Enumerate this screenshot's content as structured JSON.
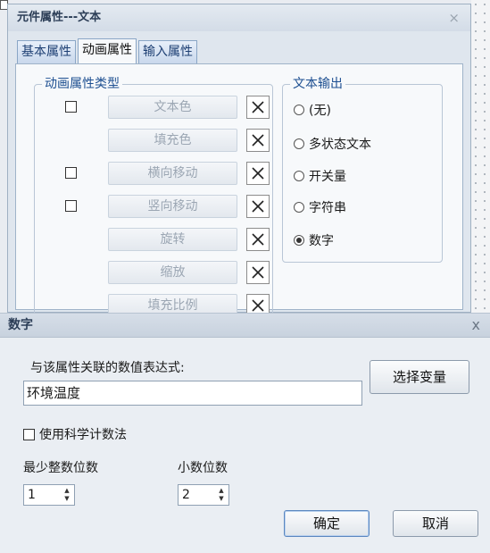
{
  "back_dialog": {
    "title": "元件属性---文本",
    "close_glyph": "×",
    "tabs": [
      {
        "label": "基本属性",
        "active": false
      },
      {
        "label": "动画属性",
        "active": true
      },
      {
        "label": "输入属性",
        "active": false
      }
    ],
    "animation_group": {
      "legend": "动画属性类型",
      "items": [
        {
          "label": "文本色",
          "has_checkbox": true
        },
        {
          "label": "填充色",
          "has_checkbox": false
        },
        {
          "label": "横向移动",
          "has_checkbox": true
        },
        {
          "label": "竖向移动",
          "has_checkbox": true
        },
        {
          "label": "旋转",
          "has_checkbox": false
        },
        {
          "label": "缩放",
          "has_checkbox": false
        },
        {
          "label": "填充比例",
          "has_checkbox": false
        }
      ]
    },
    "text_output_group": {
      "legend": "文本输出",
      "options": [
        {
          "label": "(无)",
          "selected": false
        },
        {
          "label": "多状态文本",
          "selected": false
        },
        {
          "label": "开关量",
          "selected": false
        },
        {
          "label": "字符串",
          "selected": false
        },
        {
          "label": "数字",
          "selected": true
        }
      ]
    }
  },
  "front_dialog": {
    "title": "数字",
    "close_glyph": "x",
    "expression_label": "与该属性关联的数值表达式:",
    "expression_value": "环境温度",
    "select_variable_button": "选择变量",
    "scientific_notation_label": "使用科学计数法",
    "scientific_notation_checked": false,
    "min_integer_digits_label": "最少整数位数",
    "min_integer_digits_value": "1",
    "decimal_digits_label": "小数位数",
    "decimal_digits_value": "2",
    "ok_button": "确定",
    "cancel_button": "取消"
  },
  "colors": {
    "title_text": "#2c3e57",
    "legend_text": "#1d4f91",
    "disabled_button_text": "#9ba6b3"
  }
}
